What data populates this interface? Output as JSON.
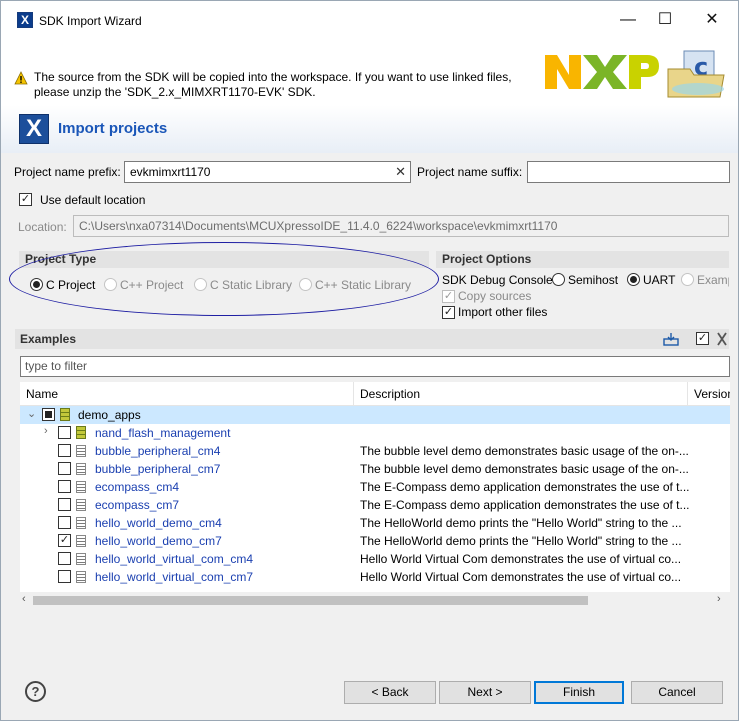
{
  "window": {
    "title": "SDK Import Wizard",
    "minimize": "—",
    "maximize": "☐",
    "close": "✕"
  },
  "header": {
    "warning": "The source from the SDK will be copied into the workspace. If you want to use linked files, please unzip the 'SDK_2.x_MIMXRT1170-EVK' SDK.",
    "page_title": "Import projects",
    "logo_text": "NXP"
  },
  "form": {
    "prefix_label": "Project name prefix:",
    "prefix_value": "evkmimxrt1170",
    "suffix_label": "Project name suffix:",
    "suffix_value": "",
    "use_default_label": "Use default location",
    "location_label": "Location:",
    "location_value": "C:\\Users\\nxa07314\\Documents\\MCUXpressoIDE_11.4.0_6224\\workspace\\evkmimxrt1170"
  },
  "project_type": {
    "header": "Project Type",
    "options": [
      "C Project",
      "C++ Project",
      "C Static Library",
      "C++ Static Library"
    ],
    "selected": "C Project"
  },
  "project_options": {
    "header": "Project Options",
    "debug_console_label": "SDK Debug Console",
    "semihost_label": "Semihost",
    "uart_label": "UART",
    "example_label": "Examp",
    "copy_sources_label": "Copy sources",
    "import_other_label": "Import other files"
  },
  "examples": {
    "header": "Examples",
    "filter_placeholder": "type to filter",
    "columns": [
      "Name",
      "Description",
      "Version"
    ],
    "rows": [
      {
        "name": "demo_apps",
        "desc": ""
      },
      {
        "name": "nand_flash_management",
        "desc": ""
      },
      {
        "name": "bubble_peripheral_cm4",
        "desc": "The bubble level demo demonstrates basic usage of the on-..."
      },
      {
        "name": "bubble_peripheral_cm7",
        "desc": "The bubble level demo demonstrates basic usage of the on-..."
      },
      {
        "name": "ecompass_cm4",
        "desc": "The E-Compass demo application demonstrates the use of t..."
      },
      {
        "name": "ecompass_cm7",
        "desc": "The E-Compass demo application demonstrates the use of t..."
      },
      {
        "name": "hello_world_demo_cm4",
        "desc": "The HelloWorld demo prints the \"Hello World\" string to the ..."
      },
      {
        "name": "hello_world_demo_cm7",
        "desc": "The HelloWorld demo prints the \"Hello World\" string to the ..."
      },
      {
        "name": "hello_world_virtual_com_cm4",
        "desc": "Hello World Virtual Com demonstrates the use of virtual co..."
      },
      {
        "name": "hello_world_virtual_com_cm7",
        "desc": "Hello World Virtual Com demonstrates the use of virtual co..."
      }
    ]
  },
  "buttons": {
    "help": "?",
    "back": "< Back",
    "next": "Next >",
    "finish": "Finish",
    "cancel": "Cancel"
  },
  "colors": {
    "accent": "#0078d7",
    "link": "#1a3fb0",
    "title_blue": "#1a56b8",
    "annotation": "#1f1fa3"
  }
}
